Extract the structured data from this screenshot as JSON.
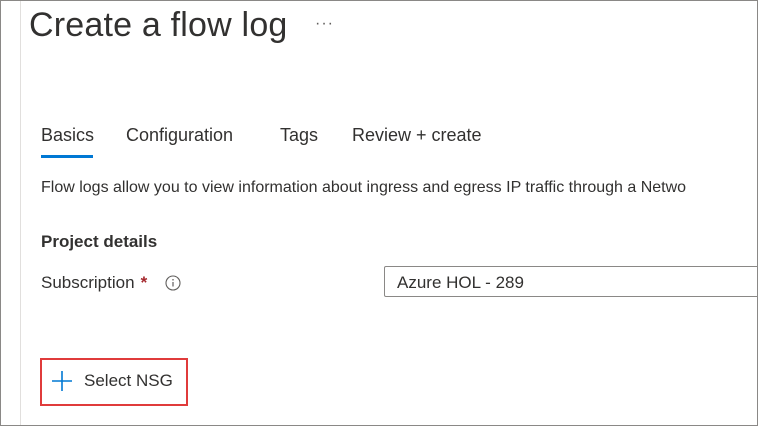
{
  "page": {
    "title": "Create a flow log",
    "more_icon": "more-horizontal-icon",
    "more_glyph": "···"
  },
  "tabs": [
    {
      "label": "Basics",
      "active": true
    },
    {
      "label": "Configuration",
      "active": false
    },
    {
      "label": "Tags",
      "active": false
    },
    {
      "label": "Review + create",
      "active": false
    }
  ],
  "description": "Flow logs allow you to view information about ingress and egress IP traffic through a Netwo",
  "project_details": {
    "heading": "Project details",
    "subscription": {
      "label": "Subscription",
      "required_marker": "*",
      "info_icon": "info-icon",
      "value": "Azure HOL - 289"
    }
  },
  "select_nsg": {
    "label": "Select NSG",
    "icon": "plus-icon",
    "highlight_color": "#e03b3b"
  },
  "colors": {
    "accent": "#0078d4",
    "text": "#323130",
    "required": "#a4262c",
    "border": "#8a8886"
  }
}
